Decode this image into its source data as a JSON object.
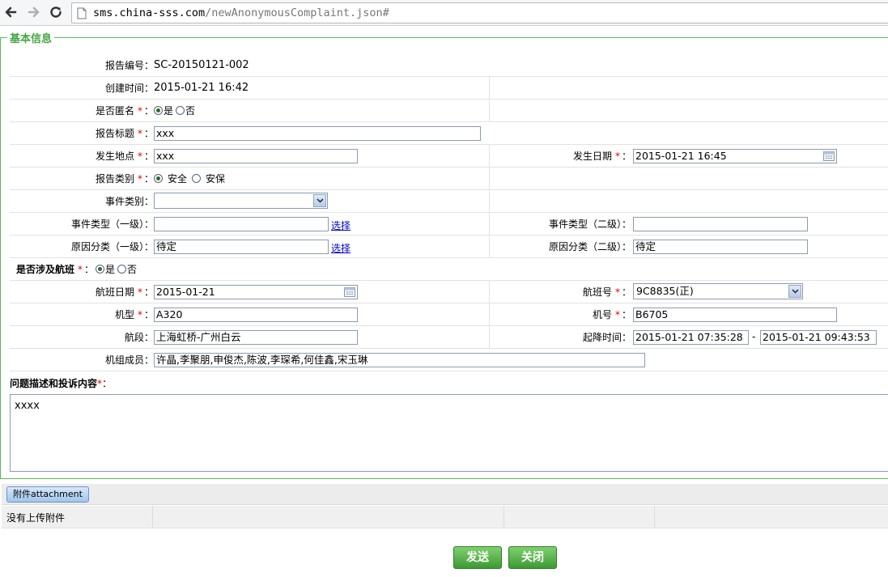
{
  "browser": {
    "url_host": "sms.china-sss.com",
    "url_path": "/newAnonymousComplaint.json#"
  },
  "section": {
    "legend": "基本信息"
  },
  "form": {
    "report_no": {
      "label": "报告编号：",
      "value": "SC-20150121-002"
    },
    "created": {
      "label": "创建时间：",
      "value": "2015-01-21 16:42"
    },
    "anonymous": {
      "label": "是否匿名",
      "yes": "是",
      "no": "否",
      "selected": "是"
    },
    "title": {
      "label": "报告标题",
      "value": "xxx"
    },
    "location": {
      "label": "发生地点",
      "value": "xxx"
    },
    "occur_date": {
      "label": "发生日期",
      "value": "2015-01-21 16:45"
    },
    "report_type": {
      "label": "报告类别",
      "opt1": "安全",
      "opt2": "安保",
      "selected": "安全"
    },
    "event_category": {
      "label": "事件类别：",
      "value": ""
    },
    "event_type1": {
      "label": "事件类型（一级）：",
      "value": "",
      "link": "选择"
    },
    "event_type2": {
      "label": "事件类型（二级）：",
      "value": ""
    },
    "cause1": {
      "label": "原因分类（一级）：",
      "value": "待定",
      "link": "选择"
    },
    "cause2": {
      "label": "原因分类（二级）：",
      "value": "待定"
    },
    "flight_involved": {
      "label": "是否涉及航班",
      "yes": "是",
      "no": "否",
      "selected": "是"
    },
    "flight_date": {
      "label": "航班日期",
      "value": "2015-01-21"
    },
    "flight_no": {
      "label": "航班号",
      "value": "9C8835(正)"
    },
    "aircraft_type": {
      "label": "机型",
      "value": "A320"
    },
    "aircraft_no": {
      "label": "机号",
      "value": "B6705"
    },
    "route": {
      "label": "航段：",
      "value": "上海虹桥-广州白云"
    },
    "takeoff_landing": {
      "label": "起降时间：",
      "start": "2015-01-21 07:35:28",
      "sep": "-",
      "end": "2015-01-21 09:43:53"
    },
    "crew": {
      "label": "机组成员：",
      "value": "许晶,李聚朋,申俊杰,陈波,李琛希,何佳鑫,宋玉琳"
    },
    "description": {
      "label": "问题描述和投诉内容",
      "value": "xxxx"
    },
    "required_mark": "*",
    "colon": "："
  },
  "attachment": {
    "button": "附件attachment",
    "empty_text": "没有上传附件"
  },
  "actions": {
    "send": "发送",
    "close": "关闭"
  },
  "colors": {
    "accent_green": "#45a545",
    "required_red": "#e00000",
    "link_blue": "#0000cc"
  }
}
